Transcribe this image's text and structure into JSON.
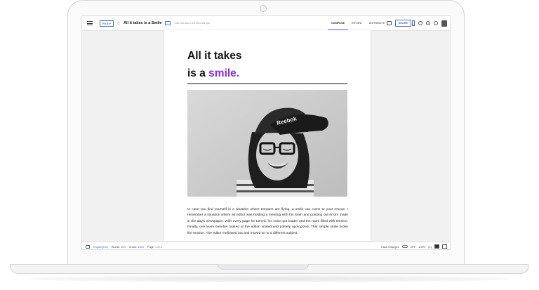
{
  "toolbar": {
    "file_label": "FILE ▾",
    "doc_title": "All it takes is a Smile",
    "last_edit": "Last edit was a few seconds ago",
    "tabs": [
      "COMPOSE",
      "REVIEW",
      "DISTRIBUTE"
    ],
    "share_label": "SHARE"
  },
  "document": {
    "heading_line1": "All it takes",
    "heading_line2_prefix": "is a ",
    "heading_line2_accent": "smile.",
    "accent_color": "#8a2be2",
    "body": "In case you find yourself in a situation where tempers are flying, a smile can come to your rescue. I remember a situation where an editor was holding a meeting with his team and pointing out errors made in the day's newspaper. With every page he turned, his voice got louder and the room filled with tension. Finally, one team member looked at the editor, smiled and politely apologized. That simple smile broke the tension. The editor mellowed out and moved on to a different subject."
  },
  "statusbar": {
    "language": "English(US)",
    "words_label": "Words:",
    "words_value": "253",
    "chars_label": "Chars:",
    "chars_value": "1304",
    "page_label": "Page:",
    "page_value": "1",
    "page_of": "of 4",
    "track_changes": "Track Changes",
    "track_state": "OFF",
    "zoom": "100%",
    "comments_count": "(1)"
  }
}
